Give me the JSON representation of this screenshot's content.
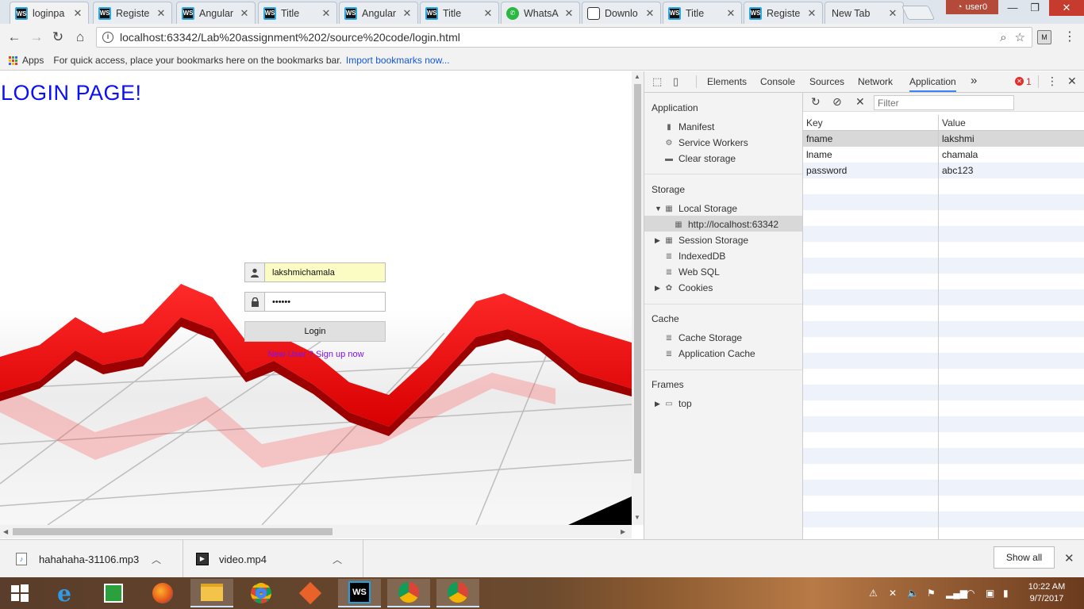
{
  "browser": {
    "tabs": [
      {
        "title": "loginpa",
        "icon": "webstorm-icon",
        "active": true
      },
      {
        "title": "Registe",
        "icon": "webstorm-icon"
      },
      {
        "title": "Angular",
        "icon": "webstorm-icon"
      },
      {
        "title": "Title",
        "icon": "webstorm-icon"
      },
      {
        "title": "Angular",
        "icon": "webstorm-icon"
      },
      {
        "title": "Title",
        "icon": "webstorm-icon"
      },
      {
        "title": "WhatsA",
        "icon": "whatsapp-icon"
      },
      {
        "title": "Downlo",
        "icon": "download-icon"
      },
      {
        "title": "Title",
        "icon": "webstorm-icon"
      },
      {
        "title": "Registe",
        "icon": "webstorm-icon"
      },
      {
        "title": "New Tab",
        "icon": "none"
      }
    ],
    "profile_name": "user0",
    "url": "localhost:63342/Lab%20assignment%202/source%20code/login.html",
    "bookmarks": {
      "apps_label": "Apps",
      "hint": "For quick access, place your bookmarks here on the bookmarks bar.",
      "import_link": "Import bookmarks now..."
    }
  },
  "page": {
    "title": "LOGIN PAGE!",
    "username_value": "lakshmichamala",
    "password_value": "••••••",
    "login_label": "Login",
    "signup_link": "New User ? Sign up now"
  },
  "devtools": {
    "tabs": [
      "Elements",
      "Console",
      "Sources",
      "Network",
      "Application"
    ],
    "more_tabs": "»",
    "error_count": "1",
    "sidebar": {
      "application_header": "Application",
      "application_items": [
        "Manifest",
        "Service Workers",
        "Clear storage"
      ],
      "storage_header": "Storage",
      "local_storage": "Local Storage",
      "local_origin": "http://localhost:63342",
      "session_storage": "Session Storage",
      "indexeddb": "IndexedDB",
      "websql": "Web SQL",
      "cookies": "Cookies",
      "cache_header": "Cache",
      "cache_items": [
        "Cache Storage",
        "Application Cache"
      ],
      "frames_header": "Frames",
      "frames_top": "top"
    },
    "filter_placeholder": "Filter",
    "grid": {
      "key_header": "Key",
      "value_header": "Value",
      "rows": [
        {
          "key": "fname",
          "value": "lakshmi"
        },
        {
          "key": "lname",
          "value": "chamala"
        },
        {
          "key": "password",
          "value": "abc123"
        }
      ]
    }
  },
  "downloads": {
    "items": [
      {
        "name": "hahahaha-31106.mp3"
      },
      {
        "name": "video.mp4"
      }
    ],
    "show_all_label": "Show all"
  },
  "taskbar": {
    "time": "10:22 AM",
    "date": "9/7/2017"
  }
}
